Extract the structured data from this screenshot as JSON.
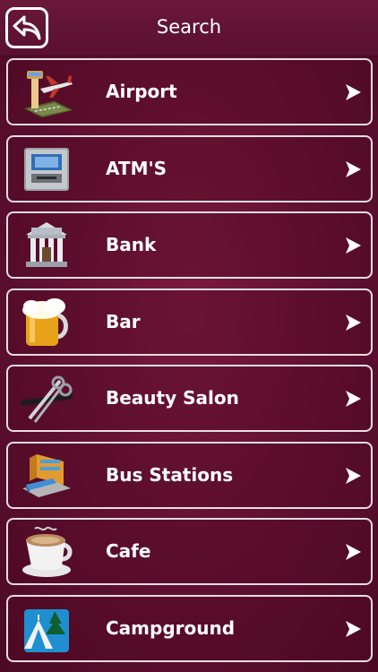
{
  "header": {
    "title": "Search",
    "back_icon": "back-arrow-icon"
  },
  "items": [
    {
      "label": "Airport",
      "icon": "airport-icon"
    },
    {
      "label": "ATM'S",
      "icon": "atm-icon"
    },
    {
      "label": "Bank",
      "icon": "bank-icon"
    },
    {
      "label": "Bar",
      "icon": "beer-mug-icon"
    },
    {
      "label": "Beauty Salon",
      "icon": "scissors-comb-icon"
    },
    {
      "label": "Bus Stations",
      "icon": "bus-station-icon"
    },
    {
      "label": "Cafe",
      "icon": "coffee-cup-icon"
    },
    {
      "label": "Campground",
      "icon": "campground-icon"
    }
  ],
  "colors": {
    "background": "#5c0f2d",
    "row_border": "#e8dde2",
    "text": "#ffffff"
  }
}
